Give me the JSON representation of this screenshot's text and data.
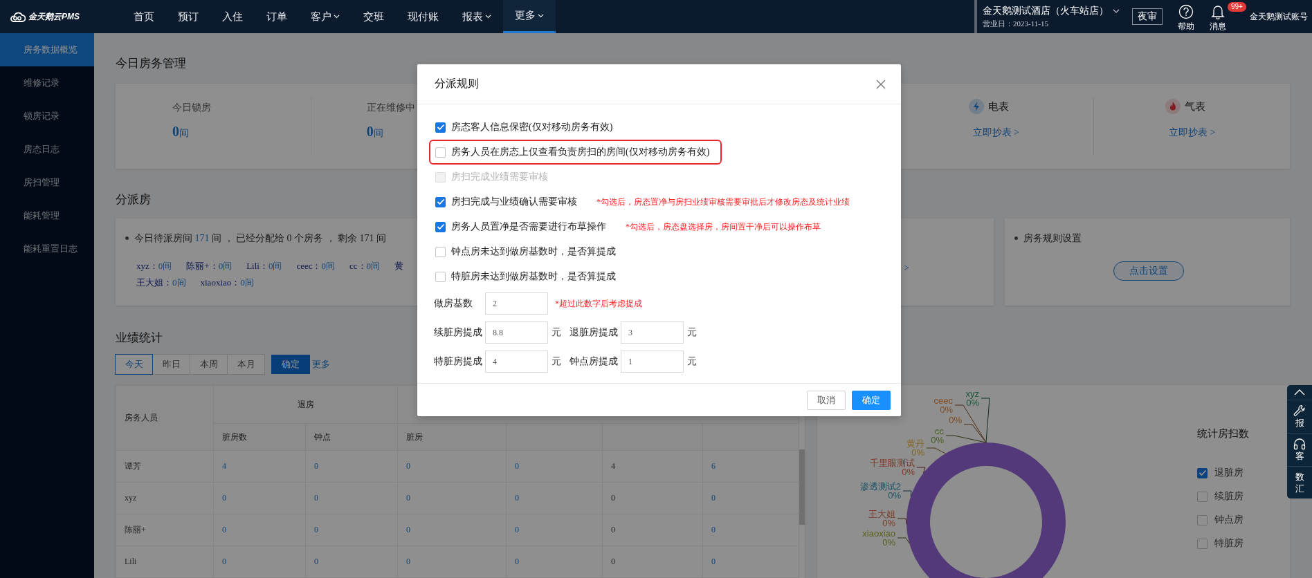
{
  "header": {
    "logo": "金天鹅云PMS",
    "nav": [
      {
        "label": "首页",
        "dropdown": false,
        "selected": false
      },
      {
        "label": "预订",
        "dropdown": false,
        "selected": false
      },
      {
        "label": "入住",
        "dropdown": false,
        "selected": false
      },
      {
        "label": "订单",
        "dropdown": false,
        "selected": false
      },
      {
        "label": "客户",
        "dropdown": true,
        "selected": false
      },
      {
        "label": "交班",
        "dropdown": false,
        "selected": false
      },
      {
        "label": "现付账",
        "dropdown": false,
        "selected": false
      },
      {
        "label": "报表",
        "dropdown": true,
        "selected": false
      },
      {
        "label": "更多",
        "dropdown": true,
        "selected": true
      }
    ],
    "hotel": "金天鹅测试酒店（火车站店）",
    "business_date": "营业日：2023-11-15",
    "night_audit": "夜审",
    "help": "帮助",
    "messages": "消息",
    "message_badge": "99+",
    "account": "金天鹅测试账号"
  },
  "sidebar": {
    "items": [
      {
        "label": "房务数据概览",
        "selected": true
      },
      {
        "label": "维修记录",
        "selected": false
      },
      {
        "label": "锁房记录",
        "selected": false
      },
      {
        "label": "房态日志",
        "selected": false
      },
      {
        "label": "房扫管理",
        "selected": false
      },
      {
        "label": "能耗管理",
        "selected": false
      },
      {
        "label": "能耗重置日志",
        "selected": false
      }
    ]
  },
  "room_overview": {
    "title": "今日房务管理",
    "counts": [
      {
        "label": "今日锁房",
        "value": "0",
        "unit": "间"
      },
      {
        "label": "正在维修中",
        "value": "0",
        "unit": "间"
      }
    ],
    "meters": [
      {
        "kind": "electricity",
        "label": "电表",
        "link": "立即抄表 >"
      },
      {
        "kind": "gas",
        "label": "气表",
        "link": "立即抄表 >"
      }
    ]
  },
  "dispatch": {
    "title": "分派房",
    "summary": {
      "before": "今日待派房间",
      "pending": "171",
      "after": "间 ， 已经分配给 0 个房务 ， 剩余 171 间"
    },
    "staff": [
      {
        "name": "xyz：",
        "count": "0间"
      },
      {
        "name": "陈丽+：",
        "count": "0间"
      },
      {
        "name": "Lili：",
        "count": "0间"
      },
      {
        "name": "ceec：",
        "count": "0间"
      },
      {
        "name": "cc：",
        "count": "0间"
      },
      {
        "name": "黄"
      },
      {
        "name": "王大姐：",
        "count": "0间"
      },
      {
        "name": "xiaoxiao：",
        "count": "0间"
      }
    ],
    "view_link": ">",
    "rules": {
      "label": "房务规则设置",
      "button": "点击设置"
    }
  },
  "performance": {
    "title": "业绩统计",
    "periods": [
      {
        "label": "今天",
        "selected": true
      },
      {
        "label": "昨日",
        "selected": false
      },
      {
        "label": "本周",
        "selected": false
      },
      {
        "label": "本月",
        "selected": false
      }
    ],
    "confirm": "确定",
    "more": "更多",
    "table": {
      "staff_header": "房务人员",
      "group_header": "退房",
      "subheaders": [
        "脏房数",
        "钟点",
        "脏房"
      ],
      "rows": [
        {
          "name": "谭芳",
          "cells": [
            {
              "value": "4",
              "link": true
            },
            {
              "value": "0",
              "link": true
            },
            {
              "value": "0",
              "link": true
            },
            {
              "value": "0",
              "link": true
            },
            {
              "value": "4",
              "link": false
            },
            {
              "value": "6",
              "link": true
            }
          ]
        },
        {
          "name": "xyz",
          "cells": [
            {
              "value": "0",
              "link": true
            },
            {
              "value": "0",
              "link": true
            },
            {
              "value": "0",
              "link": true
            },
            {
              "value": "0",
              "link": true
            },
            {
              "value": "0",
              "link": false
            },
            {
              "value": "0",
              "link": true
            }
          ]
        },
        {
          "name": "陈丽+",
          "cells": [
            {
              "value": "0",
              "link": true
            },
            {
              "value": "0",
              "link": true
            },
            {
              "value": "0",
              "link": true
            },
            {
              "value": "0",
              "link": true
            },
            {
              "value": "0",
              "link": false
            },
            {
              "value": "0",
              "link": true
            }
          ]
        },
        {
          "name": "Lili",
          "cells": [
            {
              "value": "0",
              "link": true
            },
            {
              "value": "0",
              "link": true
            },
            {
              "value": "0",
              "link": true
            },
            {
              "value": "0",
              "link": true
            },
            {
              "value": "0",
              "link": false
            },
            {
              "value": "0",
              "link": true
            }
          ]
        }
      ]
    },
    "donut_labels": [
      {
        "name": "xyz",
        "percent": "0%",
        "color": "#1a593b"
      },
      {
        "name": "ceec",
        "percent": "0%",
        "color": "#824d22"
      },
      {
        "percent": "0%",
        "color": "#7d4c20"
      },
      {
        "name": "cc",
        "percent": "0%",
        "color": "#465e20"
      },
      {
        "name": "黄丹",
        "percent": "0%",
        "color": "#826724"
      },
      {
        "name": "千里眼测试",
        "percent": "0%",
        "color": "#7d3624"
      },
      {
        "name": "渗透测试2",
        "percent": "0%",
        "color": "#1a5163"
      },
      {
        "name": "王大姐",
        "percent": "0%",
        "color": "#793b24"
      },
      {
        "name": "xiaoxiao",
        "percent": "0%",
        "color": "#595e1f"
      }
    ],
    "legend_title": "统计房扫数",
    "filters": [
      {
        "label": "退脏房",
        "checked": true
      },
      {
        "label": "续脏房",
        "checked": false
      },
      {
        "label": "钟点房",
        "checked": false
      },
      {
        "label": "特脏房",
        "checked": false
      }
    ]
  },
  "side_tools": [
    {
      "kind": "top"
    },
    {
      "kind": "repair",
      "lines": [
        "报"
      ]
    },
    {
      "kind": "service",
      "lines": [
        "客"
      ]
    },
    {
      "kind": "report",
      "lines": [
        "数",
        "汇"
      ]
    }
  ],
  "modal": {
    "title": "分派规则",
    "options": [
      {
        "label": "房态客人信息保密(仅对移动房务有效)",
        "checked": true,
        "disabled": false,
        "highlighted": false
      },
      {
        "label": "房务人员在房态上仅查看负责房扫的房间(仅对移动房务有效)",
        "checked": false,
        "disabled": false,
        "highlighted": true
      },
      {
        "label": "房扫完成业绩需要审核",
        "checked": false,
        "disabled": true,
        "highlighted": false
      },
      {
        "label": "房扫完成与业绩确认需要审核",
        "checked": true,
        "disabled": false,
        "highlighted": false,
        "note": "*勾选后，房态置净与房扫业绩审核需要审批后才修改房态及统计业绩"
      },
      {
        "label": "房务人员置净是否需要进行布草操作",
        "checked": true,
        "disabled": false,
        "highlighted": false,
        "note": "*勾选后，房态盘选择房，房间置干净后可以操作布草"
      },
      {
        "label": "钟点房未达到做房基数时，是否算提成",
        "checked": false,
        "disabled": false,
        "highlighted": false
      },
      {
        "label": "特脏房未达到做房基数时，是否算提成",
        "checked": false,
        "disabled": false,
        "highlighted": false
      }
    ],
    "base_field": {
      "label": "做房基数",
      "value": "2",
      "note": "*超过此数字后考虑提成"
    },
    "commission_fields": [
      {
        "label": "续脏房提成",
        "value": "8.8",
        "unit": "元"
      },
      {
        "label": "退脏房提成",
        "value": "3",
        "unit": "元"
      },
      {
        "label": "特脏房提成",
        "value": "4",
        "unit": "元"
      },
      {
        "label": "钟点房提成",
        "value": "1",
        "unit": "元"
      }
    ],
    "cancel": "取消",
    "ok": "确定"
  }
}
